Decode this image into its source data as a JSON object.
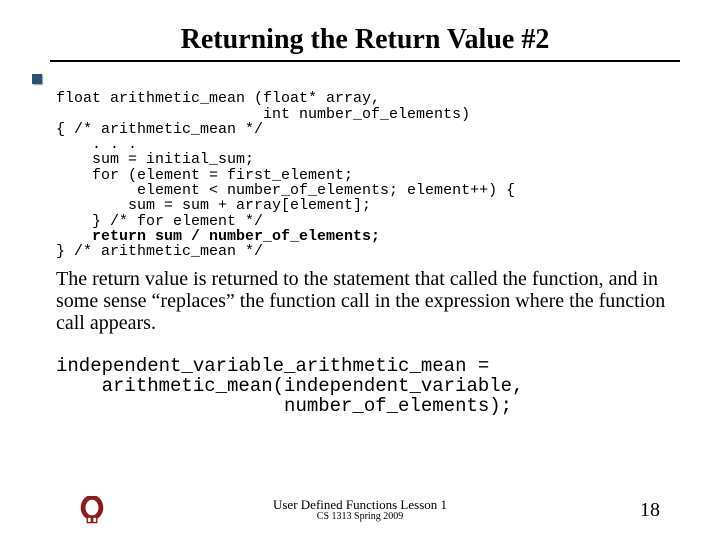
{
  "title": "Returning the Return Value #2",
  "code": {
    "l1": "float arithmetic_mean (float* array,",
    "l2": "                       int number_of_elements)",
    "l3": "{ /* arithmetic_mean */",
    "l4": "    . . .",
    "l5": "    sum = initial_sum;",
    "l6": "    for (element = first_element;",
    "l7": "         element < number_of_elements; element++) {",
    "l8": "        sum = sum + array[element];",
    "l9": "    } /* for element */",
    "l10": "    return sum / number_of_elements;",
    "l11": "} /* arithmetic_mean */"
  },
  "prose": "The return value is returned to the statement that called the function, and in some sense “replaces” the function call in the expression where the function call appears.",
  "call": {
    "l1": "independent_variable_arithmetic_mean =",
    "l2": "    arithmetic_mean(independent_variable,",
    "l3": "                    number_of_elements);"
  },
  "footer": {
    "line1": "User Defined Functions Lesson 1",
    "line2": "CS 1313 Spring 2009"
  },
  "pagenum": "18"
}
